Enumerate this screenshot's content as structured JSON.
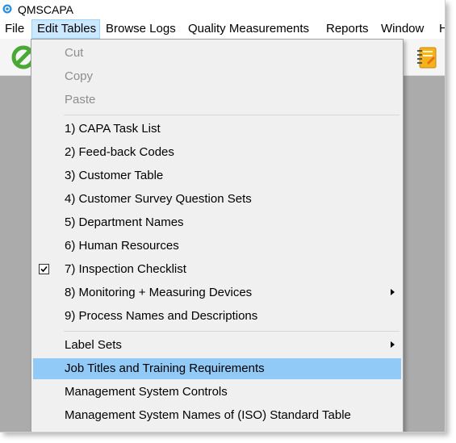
{
  "window": {
    "title": "QMSCAPA"
  },
  "menubar": {
    "items": [
      "File",
      "Edit Tables",
      "Browse Logs",
      "Quality Measurements",
      "Reports",
      "Window",
      "H"
    ]
  },
  "toolbar": {
    "icons": [
      "green-circle-icon",
      "notebook-icon"
    ]
  },
  "dropdown": {
    "items": [
      {
        "label": "Cut",
        "enabled": false
      },
      {
        "label": "Copy",
        "enabled": false
      },
      {
        "label": "Paste",
        "enabled": false
      },
      {
        "label": "1) CAPA Task List",
        "enabled": true
      },
      {
        "label": "2) Feed-back Codes",
        "enabled": true
      },
      {
        "label": "3) Customer Table",
        "enabled": true
      },
      {
        "label": "4) Customer Survey Question Sets",
        "enabled": true
      },
      {
        "label": "5) Department Names",
        "enabled": true
      },
      {
        "label": "6) Human Resources",
        "enabled": true
      },
      {
        "label": "7) Inspection Checklist",
        "enabled": true,
        "checked": true
      },
      {
        "label": "8) Monitoring + Measuring Devices",
        "enabled": true,
        "submenu": true
      },
      {
        "label": "9) Process Names and Descriptions",
        "enabled": true
      },
      {
        "label": "Label Sets",
        "enabled": true,
        "submenu": true
      },
      {
        "label": "Job Titles and Training Requirements",
        "enabled": true,
        "highlighted": true
      },
      {
        "label": "Management System Controls",
        "enabled": true
      },
      {
        "label": "Management System Names of (ISO) Standard Table",
        "enabled": true
      }
    ]
  },
  "colors": {
    "menu_highlight": "#91c9f7",
    "menubar_open": "#cce8ff",
    "workspace": "#ababab",
    "disabled_text": "#8d8d8d"
  }
}
